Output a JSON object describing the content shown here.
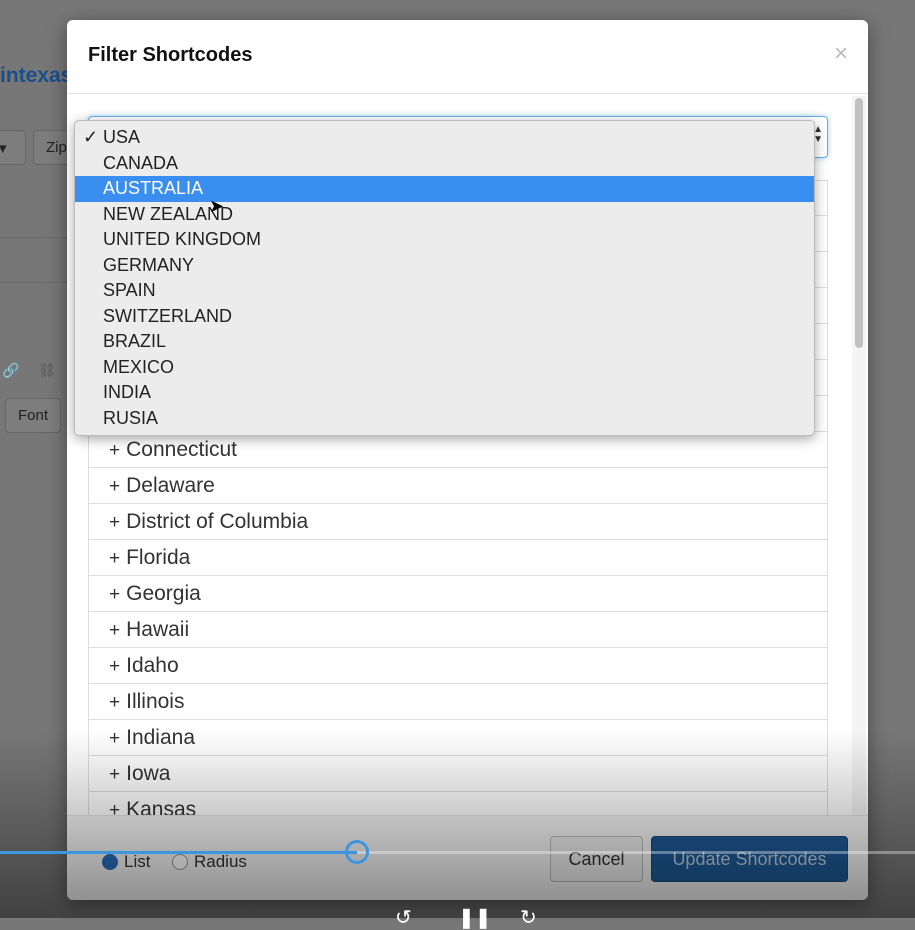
{
  "background": {
    "brand_text": "intexas",
    "zip_button": "Zip",
    "font_button": "Font"
  },
  "modal": {
    "title": "Filter Shortcodes",
    "close": "×"
  },
  "dropdown": {
    "selected": "USA",
    "highlighted": "AUSTRALIA",
    "options": [
      "USA",
      "CANADA",
      "AUSTRALIA",
      "NEW ZEALAND",
      "UNITED KINGDOM",
      "GERMANY",
      "SPAIN",
      "SWITZERLAND",
      "BRAZIL",
      "MEXICO",
      "INDIA",
      "RUSIA"
    ]
  },
  "states": [
    "Connecticut",
    "Delaware",
    "District of Columbia",
    "Florida",
    "Georgia",
    "Hawaii",
    "Idaho",
    "Illinois",
    "Indiana",
    "Iowa",
    "Kansas"
  ],
  "footer": {
    "radio_list": "List",
    "radio_radius": "Radius",
    "selected": "List",
    "cancel": "Cancel",
    "update": "Update Shortcodes"
  },
  "video": {
    "progress_percent": 39
  },
  "colors": {
    "highlight": "#3a8ef0",
    "primary_button": "#1d5a96",
    "progress": "#3d95e0"
  }
}
